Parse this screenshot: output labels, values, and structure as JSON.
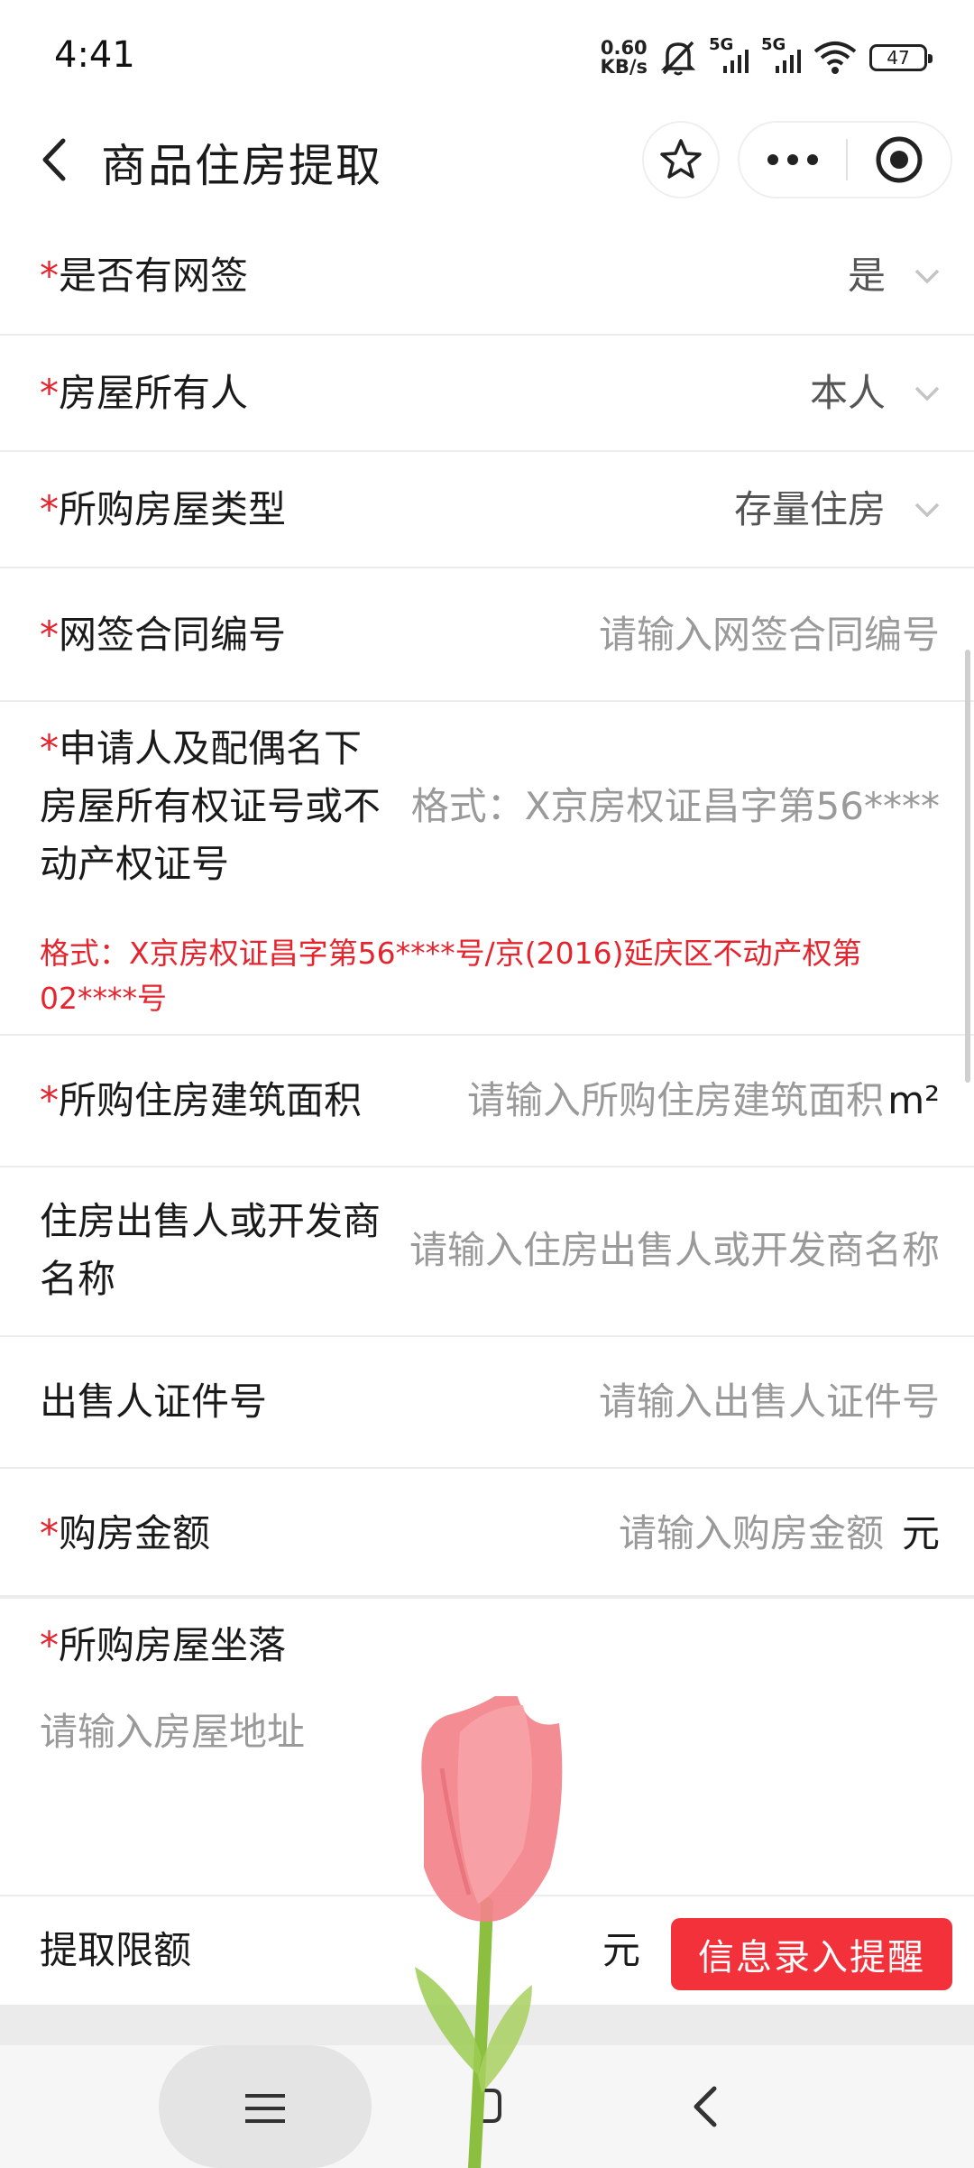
{
  "status_bar": {
    "time": "4:41",
    "net_speed_value": "0.60",
    "net_speed_unit": "KB/s",
    "signal_1_tag": "5G",
    "signal_2_tag": "5G",
    "battery": "47",
    "icons": [
      "bell-muted-icon",
      "signal-icon",
      "wifi-icon",
      "battery-icon"
    ]
  },
  "header": {
    "title": "商品住房提取",
    "icons": [
      "back-icon",
      "star-icon",
      "more-icon",
      "target-icon"
    ]
  },
  "form": {
    "online_sign": {
      "label": "是否有网签",
      "value": "是"
    },
    "owner": {
      "label": "房屋所有人",
      "value": "本人"
    },
    "house_type": {
      "label": "所购房屋类型",
      "value": "存量住房"
    },
    "contract_no": {
      "label": "网签合同编号",
      "placeholder": "请输入网签合同编号"
    },
    "property_cert": {
      "label_line1": "申请人及配偶名下",
      "label_line2": "房屋所有权证号或不",
      "label_line3": "动产权证号",
      "placeholder": "格式：X京房权证昌字第56****",
      "hint": "格式：X京房权证昌字第56****号/京(2016)延庆区不动产权第02****号"
    },
    "area": {
      "label": "所购住房建筑面积",
      "placeholder": "请输入所购住房建筑面积",
      "unit": "m²"
    },
    "seller": {
      "label_line1": "住房出售人或开发商",
      "label_line2": "名称",
      "placeholder": "请输入住房出售人或开发商名称"
    },
    "seller_id": {
      "label": "出售人证件号",
      "placeholder": "请输入出售人证件号"
    },
    "amount": {
      "label": "购房金额",
      "placeholder": "请输入购房金额",
      "unit": "元"
    },
    "address": {
      "label": "所购房屋坐落",
      "placeholder": "请输入房屋地址"
    }
  },
  "footer": {
    "quota_label": "提取限额",
    "quota_unit": "元",
    "remind_button": "信息录入提醒"
  },
  "required_mark": "*",
  "colors": {
    "accent_red": "#f2313a",
    "required_red": "#e5242e"
  }
}
